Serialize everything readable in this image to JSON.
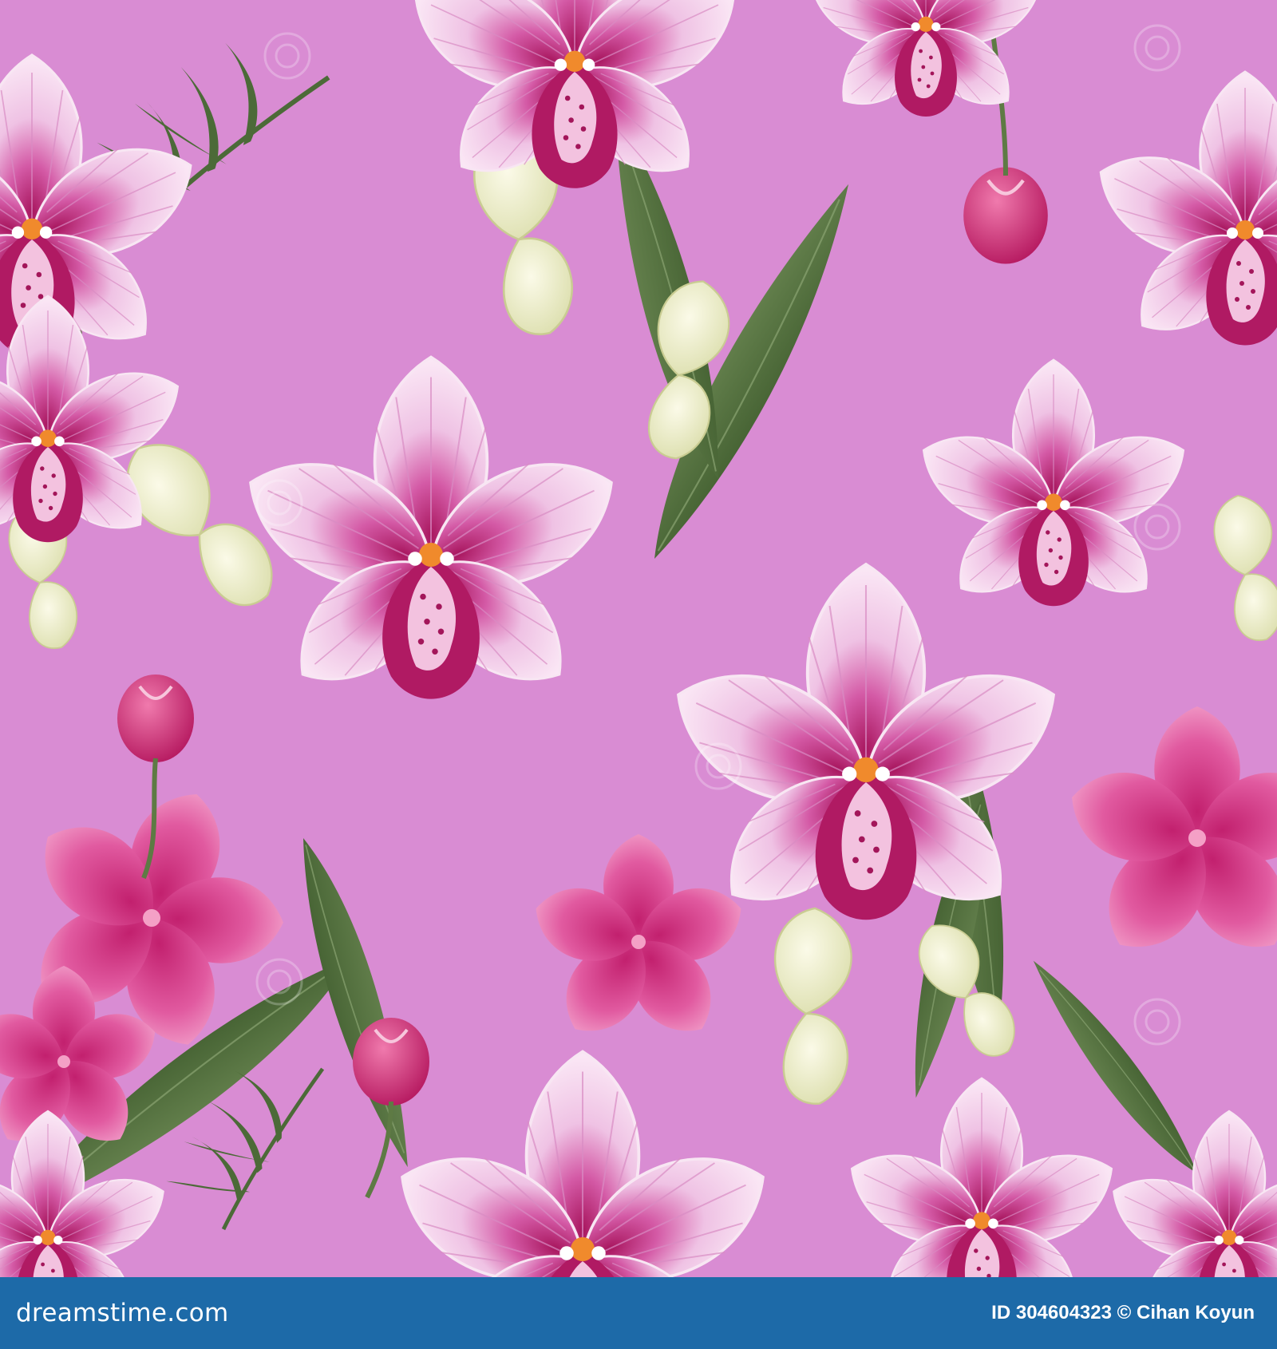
{
  "image": {
    "subject": "seamless orchid floral pattern",
    "colors": {
      "background": "#d98cd3",
      "petal_light": "#f7dbef",
      "petal_mid": "#e8a6d6",
      "magenta": "#b51f6b",
      "leaf": "#4c6a38",
      "cream": "#f2efcb",
      "bud": "#cf2e78"
    }
  },
  "footer": {
    "brand": "dreamstime.com",
    "stock_id": "ID 304604323",
    "copyright": "© Cihan Koyun",
    "background": "#1d6aa8"
  }
}
